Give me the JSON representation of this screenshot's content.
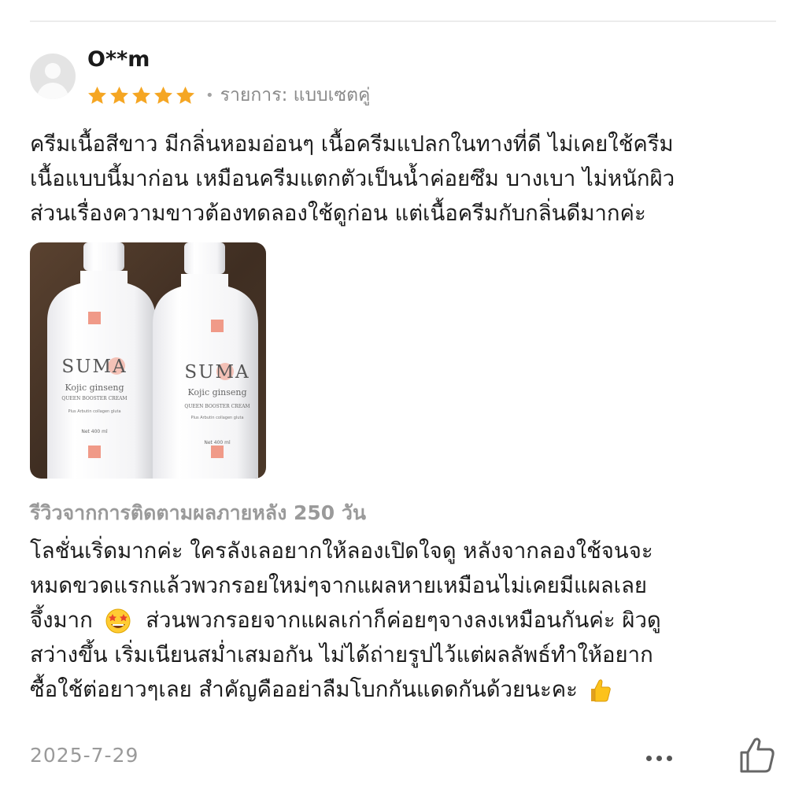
{
  "review": {
    "username": "O**m",
    "rating": 5,
    "rating_max": 5,
    "variant_label": "รายการ: แบบเซตคู่",
    "text_lines": [
      "ครีมเนื้อสีขาว มีกลิ่นหอมอ่อนๆ เนื้อครีมแปลกในทางที่ดี ไม่เคยใช้ครีม",
      "เนื้อแบบนี้มาก่อน เหมือนครีมแตกตัวเป็นน้ำค่อยซึม บางเบา ไม่หนักผิว",
      "ส่วนเรื่องความขาวต้องทดลองใช้ดูก่อน แต่เนื้อครีมกับกลิ่นดีมากค่ะ"
    ],
    "photo": {
      "brand": "SUMA",
      "product_line": "Kojic ginseng",
      "product_name": "QUEEN BOOSTER CREAM",
      "product_sub": "Plus Arbutin collagen gluta",
      "net": "Net 400 ml"
    },
    "followup_title": "รีวิวจากการติดตามผลภายหลัง 250 วัน",
    "followup_lines": [
      "โลชั่นเริ่ดมากค่ะ ใครลังเลอยากให้ลองเปิดใจดู หลังจากลองใช้จนจะ",
      "หมดขวดแรกแล้วพวกรอยใหม่ๆจากแผลหายเหมือนไม่เคยมีแผลเลย",
      "จึ้งมาก",
      "ส่วนพวกรอยจากแผลเก่าก็ค่อยๆจางลงเหมือนกันค่ะ ผิวดู",
      "สว่างขึ้น เริ่มเนียนสม่ำเสมอกัน ไม่ได้ถ่ายรูปไว้แต่ผลลัพธ์ทำให้อยาก",
      "ซื้อใช้ต่อยาวๆเลย สำคัญคืออย่าลืมโบกกันแดดกันด้วยนะคะ"
    ],
    "date": "2025-7-29",
    "icons": [
      "avatar-placeholder-icon",
      "star-icon",
      "star-struck-emoji",
      "thumbs-up-emoji",
      "more-dots-icon",
      "like-icon"
    ],
    "colors": {
      "star": "#f5a623",
      "muted": "#9a9a9a",
      "text": "#1c1c1c"
    }
  }
}
